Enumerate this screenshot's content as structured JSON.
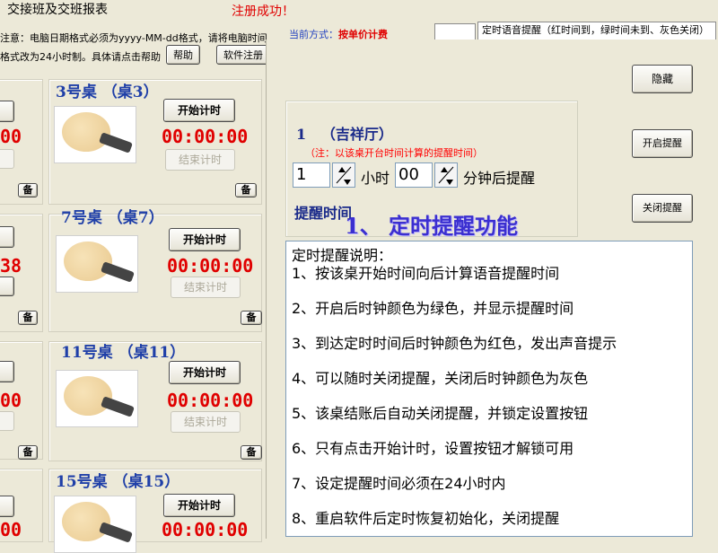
{
  "window": {
    "title": "交接班及交班报表",
    "register_status": "注册成功！"
  },
  "notice": {
    "line1": "注意：电脑日期格式必须为yyyy-MM-dd格式，请将电脑时间",
    "line2": "格式改为24小时制。具体请点击帮助",
    "help_label": "帮助",
    "register_label": "软件注册"
  },
  "mode": {
    "prefix": "当前方式：",
    "value": "按单价计费"
  },
  "tab": {
    "label": "定时语音提醒（红时间到，绿时间未到、灰色关闭）"
  },
  "tables": [
    {
      "name": "3号桌",
      "code": "（桌3）",
      "timer": "00:00:00",
      "start_label": "开始计时",
      "stop_label": "结束计时",
      "spare_label": "备"
    },
    {
      "name": "7号桌",
      "code": "（桌7）",
      "timer": "00:00:00",
      "start_label": "开始计时",
      "stop_label": "结束计时",
      "spare_label": "备"
    },
    {
      "name": "11号桌",
      "code": "（桌11）",
      "timer": "00:00:00",
      "start_label": "开始计时",
      "stop_label": "结束计时",
      "spare_label": "备"
    },
    {
      "name": "15号桌",
      "code": "（桌15）",
      "timer": "00:00:00",
      "start_label": "开始计时",
      "stop_label": "",
      "spare_label": ""
    }
  ],
  "left_partial": {
    "timers": [
      "00",
      "38",
      "00",
      "00"
    ],
    "spare_label": "备"
  },
  "reminder": {
    "table_no": "1",
    "table_name": "（吉祥厅）",
    "note": "（注：以该桌开台时间计算的提醒时间）",
    "hours_value": "1",
    "hours_label": "小时",
    "minutes_value": "00",
    "minutes_label": "分钟后提醒",
    "time_label": "提醒时间",
    "hide_label": "隐藏",
    "enable_label": "开启提醒",
    "disable_label": "关闭提醒",
    "feature_title": "1、 定时提醒功能"
  },
  "instructions": {
    "title": "定时提醒说明：",
    "lines": [
      "1、按该桌开始时间向后计算语音提醒时间",
      "2、开启后时钟颜色为绿色，并显示提醒时间",
      "3、到达定时时间后时钟颜色为红色，发出声音提示",
      "4、可以随时关闭提醒，关闭后时钟颜色为灰色",
      "5、该桌结账后自动关闭提醒，并锁定设置按钮",
      "6、只有点击开始计时，设置按钮才解锁可用",
      "7、设定提醒时间必须在24小时内",
      "8、重启软件后定时恢复初始化，关闭提醒"
    ]
  }
}
